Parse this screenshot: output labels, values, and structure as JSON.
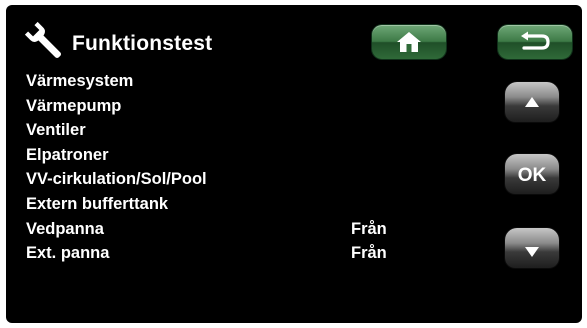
{
  "header": {
    "title": "Funktionstest",
    "icon": "wrench-icon"
  },
  "nav": {
    "home_icon": "home-icon",
    "back_icon": "back-arrow-icon"
  },
  "menu": {
    "items": [
      {
        "label": "Värmesystem",
        "value": ""
      },
      {
        "label": "Värmepump",
        "value": ""
      },
      {
        "label": "Ventiler",
        "value": ""
      },
      {
        "label": "Elpatroner",
        "value": ""
      },
      {
        "label": "VV-cirkulation/Sol/Pool",
        "value": ""
      },
      {
        "label": "Extern bufferttank",
        "value": ""
      },
      {
        "label": "Vedpanna",
        "value": "Från"
      },
      {
        "label": "Ext. panna",
        "value": "Från"
      }
    ]
  },
  "side_buttons": {
    "up_icon": "arrow-up-icon",
    "ok_label": "OK",
    "down_icon": "arrow-down-icon"
  },
  "colors": {
    "background": "#000000",
    "text": "#ffffff",
    "nav_button": "#3d7a46",
    "side_button": "#8a8a8a"
  }
}
